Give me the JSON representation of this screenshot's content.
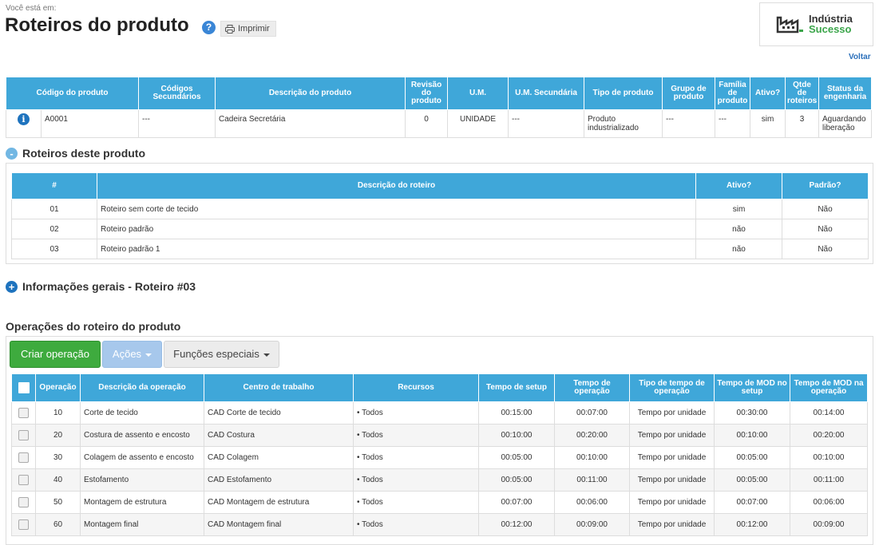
{
  "header": {
    "breadcrumb": "Você está em:",
    "title": "Roteiros do produto",
    "help": "?",
    "print_label": "Imprimir",
    "logo_line1": "Indústria",
    "logo_line2": "Sucesso",
    "back_label": "Voltar"
  },
  "product_table": {
    "headers": [
      "Código do produto",
      "Códigos Secundários",
      "Descrição do produto",
      "Revisão do produto",
      "U.M.",
      "U.M. Secundária",
      "Tipo de produto",
      "Grupo de produto",
      "Família de produto",
      "Ativo?",
      "Qtde de roteiros",
      "Status da engenharia"
    ],
    "row": {
      "info": "i",
      "code": "A0001",
      "secondary": "---",
      "description": "Cadeira Secretária",
      "revision": "0",
      "um": "UNIDADE",
      "um_secondary": "---",
      "type": "Produto industrializado",
      "group": "---",
      "family": "---",
      "active": "sim",
      "routes_count": "3",
      "status": "Aguardando liberação"
    }
  },
  "routes_section": {
    "toggle": "-",
    "title": "Roteiros deste produto",
    "headers": [
      "#",
      "Descrição do roteiro",
      "Ativo?",
      "Padrão?"
    ],
    "rows": [
      {
        "num": "01",
        "desc": "Roteiro sem corte de tecido",
        "active": "sim",
        "default": "Não"
      },
      {
        "num": "02",
        "desc": "Roteiro padrão",
        "active": "não",
        "default": "Não"
      },
      {
        "num": "03",
        "desc": "Roteiro padrão 1",
        "active": "não",
        "default": "Não"
      }
    ]
  },
  "general_info": {
    "toggle": "+",
    "title": "Informações gerais - Roteiro #03"
  },
  "operations": {
    "title": "Operações do roteiro do produto",
    "buttons": {
      "create": "Criar operação",
      "actions": "Ações",
      "special": "Funções especiais"
    },
    "headers": [
      "Operação",
      "Descrição da operação",
      "Centro de trabalho",
      "Recursos",
      "Tempo de setup",
      "Tempo de operação",
      "Tipo de tempo de operação",
      "Tempo de MOD no setup",
      "Tempo de MOD na operação"
    ],
    "rows": [
      {
        "op": "10",
        "desc": "Corte de tecido",
        "center": "CAD Corte de tecido",
        "resource": "Todos",
        "setup": "00:15:00",
        "operation": "00:07:00",
        "time_type": "Tempo por unidade",
        "mod_setup": "00:30:00",
        "mod_op": "00:14:00"
      },
      {
        "op": "20",
        "desc": "Costura de assento e encosto",
        "center": "CAD Costura",
        "resource": "Todos",
        "setup": "00:10:00",
        "operation": "00:20:00",
        "time_type": "Tempo por unidade",
        "mod_setup": "00:10:00",
        "mod_op": "00:20:00"
      },
      {
        "op": "30",
        "desc": "Colagem de assento e encosto",
        "center": "CAD Colagem",
        "resource": "Todos",
        "setup": "00:05:00",
        "operation": "00:10:00",
        "time_type": "Tempo por unidade",
        "mod_setup": "00:05:00",
        "mod_op": "00:10:00"
      },
      {
        "op": "40",
        "desc": "Estofamento",
        "center": "CAD Estofamento",
        "resource": "Todos",
        "setup": "00:05:00",
        "operation": "00:11:00",
        "time_type": "Tempo por unidade",
        "mod_setup": "00:05:00",
        "mod_op": "00:11:00"
      },
      {
        "op": "50",
        "desc": "Montagem de estrutura",
        "center": "CAD Montagem de estrutura",
        "resource": "Todos",
        "setup": "00:07:00",
        "operation": "00:06:00",
        "time_type": "Tempo por unidade",
        "mod_setup": "00:07:00",
        "mod_op": "00:06:00"
      },
      {
        "op": "60",
        "desc": "Montagem final",
        "center": "CAD Montagem final",
        "resource": "Todos",
        "setup": "00:12:00",
        "operation": "00:09:00",
        "time_type": "Tempo por unidade",
        "mod_setup": "00:12:00",
        "mod_op": "00:09:00"
      }
    ]
  }
}
